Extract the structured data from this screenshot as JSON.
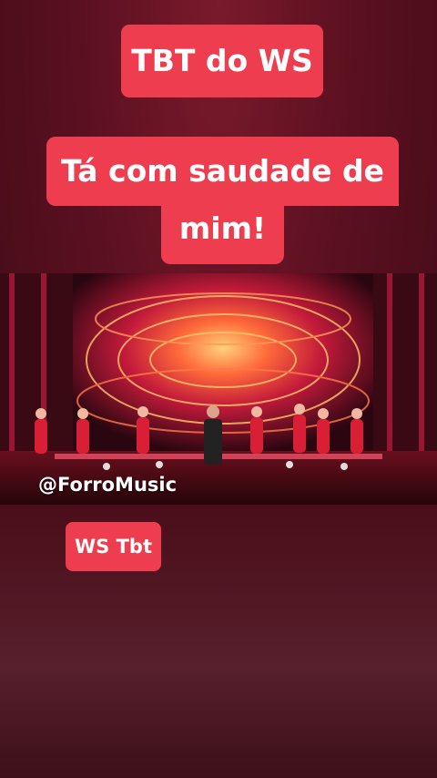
{
  "overlay": {
    "title": "TBT do WS",
    "subtitle_line1": "Tá com saudade de",
    "subtitle_line2": "mim!",
    "tag": "WS Tbt"
  },
  "video": {
    "watermark": "@ForroMusic"
  },
  "colors": {
    "tag_background": "#ee3d4f",
    "page_background": "#5a1020"
  }
}
